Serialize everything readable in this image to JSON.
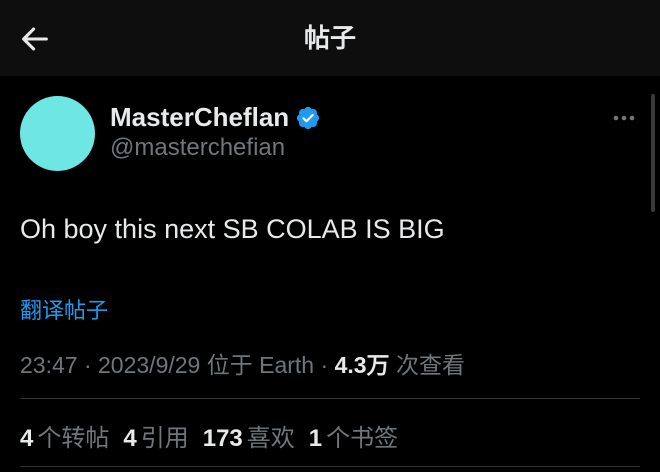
{
  "header": {
    "title": "帖子",
    "back_icon": "arrow-left-icon"
  },
  "author": {
    "display_name": "MasterCheflan",
    "handle": "@masterchefian",
    "verified_icon": "verified-badge-icon",
    "avatar_color": "#6ee6e3",
    "verified_color": "#1d9bf0"
  },
  "post": {
    "text": "Oh boy this next SB COLAB IS BIG",
    "translate_label": "翻译帖子",
    "time": "23:47",
    "date": "2023/9/29",
    "location_label": "位于 Earth",
    "views_count": "4.3万",
    "views_label": "次查看",
    "separator": "·"
  },
  "stats": {
    "reposts_count": "4",
    "reposts_label": "个转帖",
    "quotes_count": "4",
    "quotes_label": "引用",
    "likes_count": "173",
    "likes_label": "喜欢",
    "bookmarks_count": "1",
    "bookmarks_label": "个书签"
  },
  "colors": {
    "background": "#000000",
    "text_primary": "#e7e9ea",
    "text_secondary": "#71767b",
    "link": "#1d9bf0"
  }
}
